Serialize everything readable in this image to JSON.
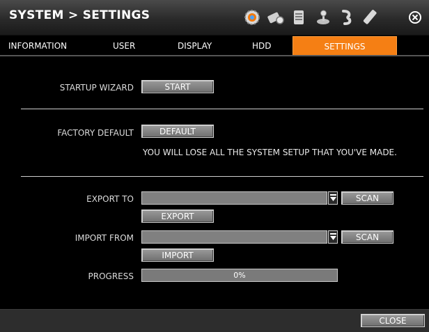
{
  "title": "SYSTEM > SETTINGS",
  "icons": [
    "settings-gear-icon",
    "camera-icon",
    "storage-icon",
    "joystick-icon",
    "network-icon",
    "usb-icon",
    "close-icon"
  ],
  "tabs": [
    {
      "label": "INFORMATION",
      "active": false
    },
    {
      "label": "USER",
      "active": false
    },
    {
      "label": "DISPLAY",
      "active": false
    },
    {
      "label": "HDD",
      "active": false
    },
    {
      "label": "SETTINGS",
      "active": true
    }
  ],
  "startup": {
    "label": "STARTUP WIZARD",
    "button": "START"
  },
  "factory": {
    "label": "FACTORY DEFAULT",
    "button": "DEFAULT",
    "warning": "YOU WILL LOSE ALL THE SYSTEM SETUP THAT YOU'VE MADE."
  },
  "export": {
    "label": "EXPORT TO",
    "value": "",
    "scan": "SCAN",
    "button": "EXPORT"
  },
  "import": {
    "label": "IMPORT FROM",
    "value": "",
    "scan": "SCAN",
    "button": "IMPORT"
  },
  "progress": {
    "label": "PROGRESS",
    "value": 0,
    "text": "0%"
  },
  "footer": {
    "close": "CLOSE"
  },
  "colors": {
    "accent": "#f57f14",
    "background": "#000000"
  }
}
